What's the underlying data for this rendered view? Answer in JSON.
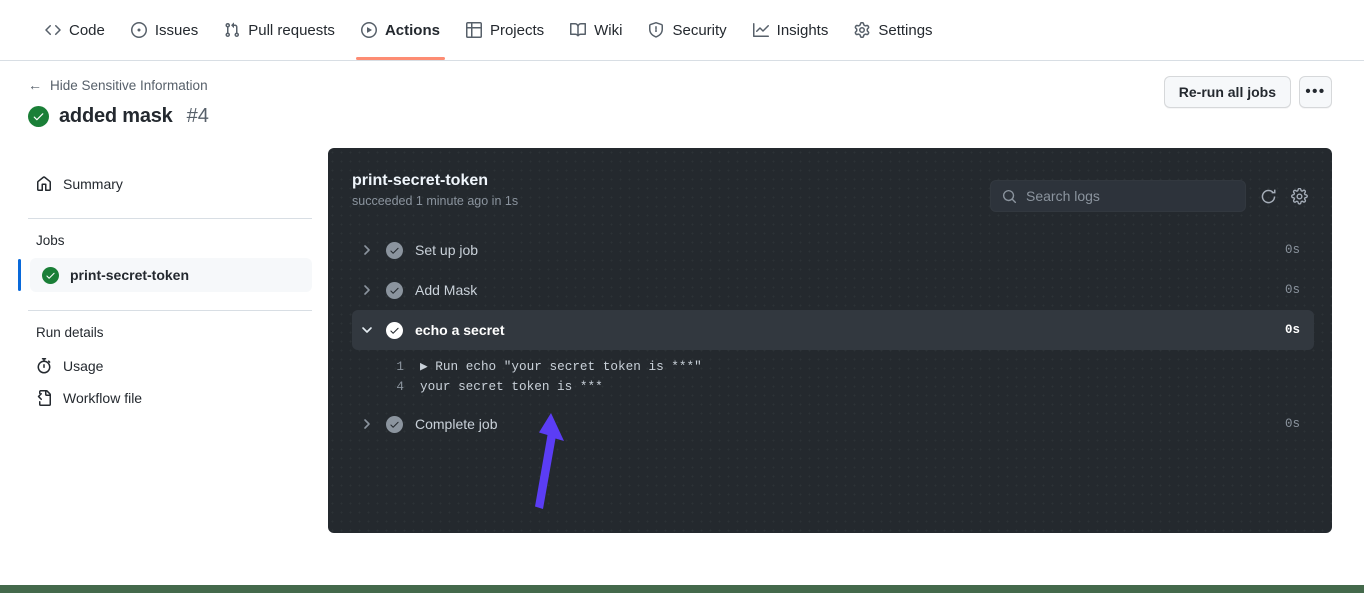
{
  "repo_nav": {
    "tabs": [
      {
        "label": "Code",
        "icon": "code-icon",
        "active": false
      },
      {
        "label": "Issues",
        "icon": "issue-opened-icon",
        "active": false
      },
      {
        "label": "Pull requests",
        "icon": "git-pull-request-icon",
        "active": false
      },
      {
        "label": "Actions",
        "icon": "play-icon",
        "active": true
      },
      {
        "label": "Projects",
        "icon": "table-icon",
        "active": false
      },
      {
        "label": "Wiki",
        "icon": "book-icon",
        "active": false
      },
      {
        "label": "Security",
        "icon": "shield-icon",
        "active": false
      },
      {
        "label": "Insights",
        "icon": "graph-icon",
        "active": false
      },
      {
        "label": "Settings",
        "icon": "gear-icon",
        "active": false
      }
    ],
    "active_underline_color": "#fd8c73"
  },
  "sidebar": {
    "back_link": "Hide Sensitive Information",
    "back_arrow": "←",
    "run_title": "added mask",
    "run_number": "#4",
    "run_status": "success",
    "summary_label": "Summary",
    "jobs_heading": "Jobs",
    "jobs": [
      {
        "label": "print-secret-token",
        "status": "success",
        "selected": true
      }
    ],
    "run_details_heading": "Run details",
    "run_details": [
      {
        "label": "Usage",
        "icon": "stopwatch-icon"
      },
      {
        "label": "Workflow file",
        "icon": "workflow-file-icon"
      }
    ],
    "selected_indicator_color": "#0969da"
  },
  "main": {
    "rerun_button": "Re-run all jobs",
    "kebab_button": "•••"
  },
  "log_panel": {
    "job_title": "print-secret-token",
    "job_subtitle": "succeeded 1 minute ago in 1s",
    "search": {
      "placeholder": "Search logs",
      "value": "",
      "icon": "search-icon"
    },
    "refresh_icon": "refresh-icon",
    "settings_icon": "gear-icon",
    "steps": [
      {
        "name": "Set up job",
        "duration": "0s",
        "status": "success",
        "expanded": false,
        "selected": false
      },
      {
        "name": "Add Mask",
        "duration": "0s",
        "status": "success",
        "expanded": false,
        "selected": false
      },
      {
        "name": "echo a secret",
        "duration": "0s",
        "status": "success",
        "expanded": true,
        "selected": true
      },
      {
        "name": "Complete job",
        "duration": "0s",
        "status": "success",
        "expanded": false,
        "selected": false
      }
    ],
    "log_lines": [
      {
        "number": "1",
        "caret": "▶ ",
        "text": "Run echo \"your secret token is ***\""
      },
      {
        "number": "4",
        "caret": "",
        "text": "your secret token is ***"
      }
    ],
    "background_color": "#24292e",
    "selected_row_color": "#32383f"
  },
  "annotation": {
    "arrow_color": "#5b3df5",
    "arrow_name": "annotation-arrow-up"
  },
  "bottom_bar": {
    "color": "#44694b"
  }
}
